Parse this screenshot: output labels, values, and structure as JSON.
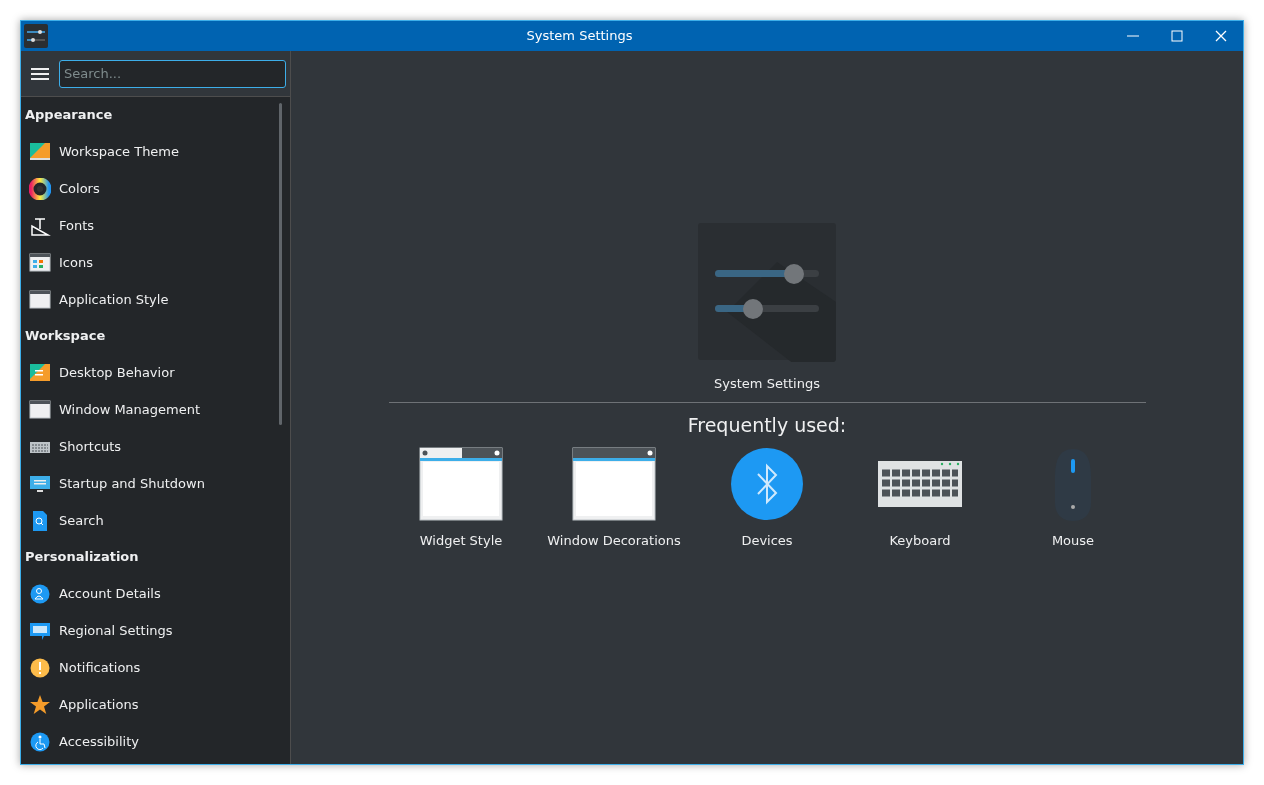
{
  "window": {
    "title": "System Settings"
  },
  "sidebar": {
    "search": {
      "placeholder": "Search..."
    },
    "groups": [
      {
        "title": "Appearance",
        "items": [
          {
            "label": "Workspace Theme"
          },
          {
            "label": "Colors"
          },
          {
            "label": "Fonts"
          },
          {
            "label": "Icons"
          },
          {
            "label": "Application Style"
          }
        ]
      },
      {
        "title": "Workspace",
        "items": [
          {
            "label": "Desktop Behavior"
          },
          {
            "label": "Window Management"
          },
          {
            "label": "Shortcuts"
          },
          {
            "label": "Startup and Shutdown"
          },
          {
            "label": "Search"
          }
        ]
      },
      {
        "title": "Personalization",
        "items": [
          {
            "label": "Account Details"
          },
          {
            "label": "Regional Settings"
          },
          {
            "label": "Notifications"
          },
          {
            "label": "Applications"
          },
          {
            "label": "Accessibility"
          }
        ]
      }
    ]
  },
  "main": {
    "title": "System Settings",
    "frequent_heading": "Frequently used:",
    "frequent": [
      {
        "label": "Widget Style"
      },
      {
        "label": "Window Decorations"
      },
      {
        "label": "Devices"
      },
      {
        "label": "Keyboard"
      },
      {
        "label": "Mouse"
      }
    ]
  }
}
